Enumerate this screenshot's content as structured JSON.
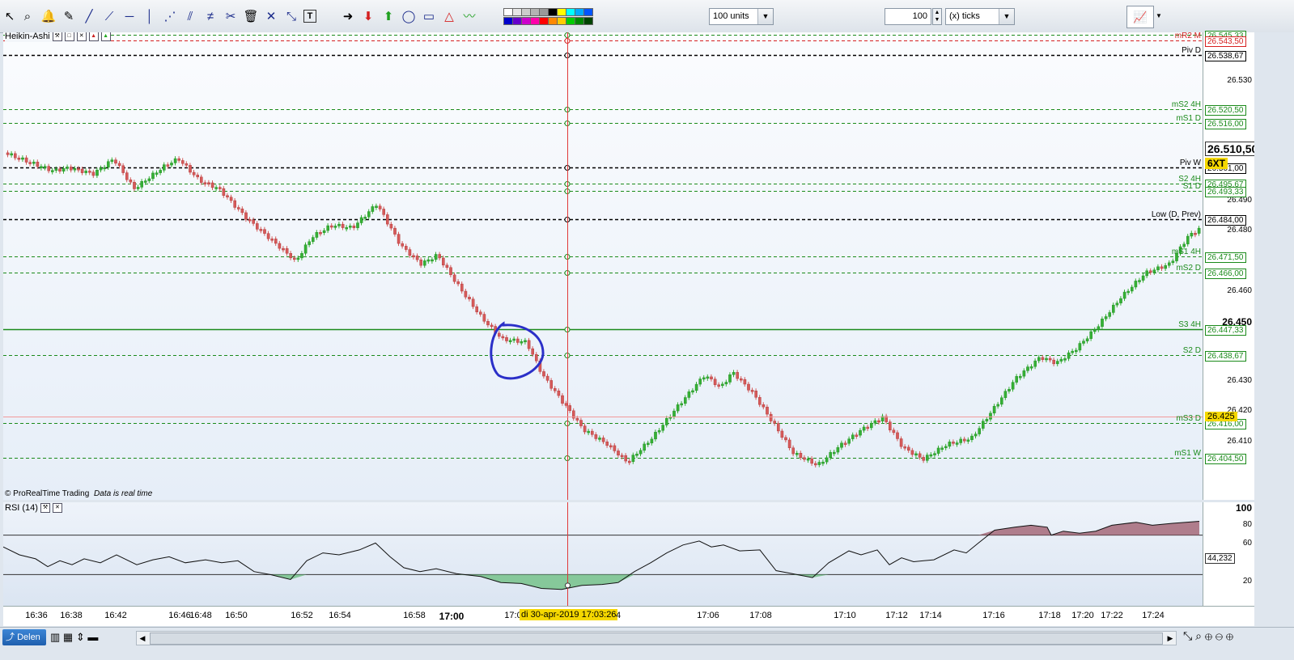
{
  "toolbar": {
    "units_value": "100 units",
    "ticks_value": "100",
    "ticks_unit": "(x) ticks",
    "icons": [
      "cursor-icon",
      "zoom-icon",
      "alarm-icon",
      "eraser-icon",
      "line-icon",
      "trendline-icon",
      "hline-icon",
      "vline-icon",
      "fan-icon",
      "parallel-icon",
      "channel-icon",
      "fibonacci-icon",
      "trash-icon",
      "cross-icon",
      "xy-icon",
      "text-icon",
      "arrow-right-icon",
      "arrow-down-icon",
      "arrow-up-icon",
      "ellipse-icon",
      "rectangle-icon",
      "triangle-icon",
      "wave-icon"
    ],
    "swatch_colors": [
      "#ffffff",
      "#e6e6e6",
      "#cccccc",
      "#b3b3b3",
      "#999999",
      "#000000",
      "#ffff00",
      "#00ffff",
      "#00aaff",
      "#0055ff",
      "#0000cc",
      "#6600cc",
      "#cc00cc",
      "#ff00aa",
      "#ff0000",
      "#ff8800",
      "#ffcc00",
      "#00cc00",
      "#008800",
      "#004400"
    ]
  },
  "price_pane": {
    "indicator_name": "Heikin-Ashi",
    "copyright": "© ProRealTime Trading",
    "data_note": "Data is real time"
  },
  "rsi_pane": {
    "indicator_name": "RSI (14)"
  },
  "price_axis": {
    "ticks": [
      "26.530",
      "26.490",
      "26.480",
      "26.460",
      "26.450",
      "26.430",
      "26.420",
      "26.410"
    ],
    "current_price": "26.510,50",
    "symbol_code": "6XT",
    "cursor_price": "26.425"
  },
  "levels": [
    {
      "label": "S1 4H",
      "value": "26.545,33",
      "color": "#1a8a1a"
    },
    {
      "label": "mR2 M",
      "value": "26.543,50",
      "color": "#d62020"
    },
    {
      "label": "Piv D",
      "value": "26.538,67",
      "color": "#000000"
    },
    {
      "label": "mS2 4H",
      "value": "26.520,50",
      "color": "#1a8a1a"
    },
    {
      "label": "mS1 D",
      "value": "26.516,00",
      "color": "#1a8a1a"
    },
    {
      "label": "Piv W",
      "value": "26.501,00",
      "color": "#000000"
    },
    {
      "label": "S2 4H",
      "value": "26.495,67",
      "color": "#1a8a1a"
    },
    {
      "label": "S1 D",
      "value": "26.493,33",
      "color": "#1a8a1a"
    },
    {
      "label": "Low (D, Prev)",
      "value": "26.484,00",
      "color": "#000000"
    },
    {
      "label": "mS1 4H",
      "value": "26.471,50",
      "color": "#1a8a1a"
    },
    {
      "label": "mS2 D",
      "value": "26.466,00",
      "color": "#1a8a1a"
    },
    {
      "label": "S3 4H",
      "value": "26.447,33",
      "color": "#1a8a1a"
    },
    {
      "label": "S2 D",
      "value": "26.438,67",
      "color": "#1a8a1a"
    },
    {
      "label": "mS3 D",
      "value": "26.416,00",
      "color": "#1a8a1a"
    },
    {
      "label": "mS1 W",
      "value": "26.404,50",
      "color": "#1a8a1a"
    }
  ],
  "rsi_axis": {
    "ticks": [
      "100",
      "80",
      "60",
      "20"
    ],
    "current_value": "44,232"
  },
  "time_axis": {
    "labels": [
      "16:36",
      "16:38",
      "16:42",
      "16:46",
      "16:48",
      "16:50",
      "16:52",
      "16:54",
      "16:58",
      "17:00",
      "17:0",
      "17:06",
      "17:08",
      "17:10",
      "17:12",
      "17:14",
      "17:16",
      "17:18",
      "17:20",
      "17:22",
      "17:24"
    ],
    "cursor_time": "di 30-apr-2019 17:03:26",
    "cursor_tail": "4"
  },
  "statusbar": {
    "delen_label": "Delen"
  },
  "colors": {
    "bull": "#35b035",
    "bear": "#d65a5a",
    "annotation": "#2b2fc8",
    "cursor": "#e03a3a"
  }
}
